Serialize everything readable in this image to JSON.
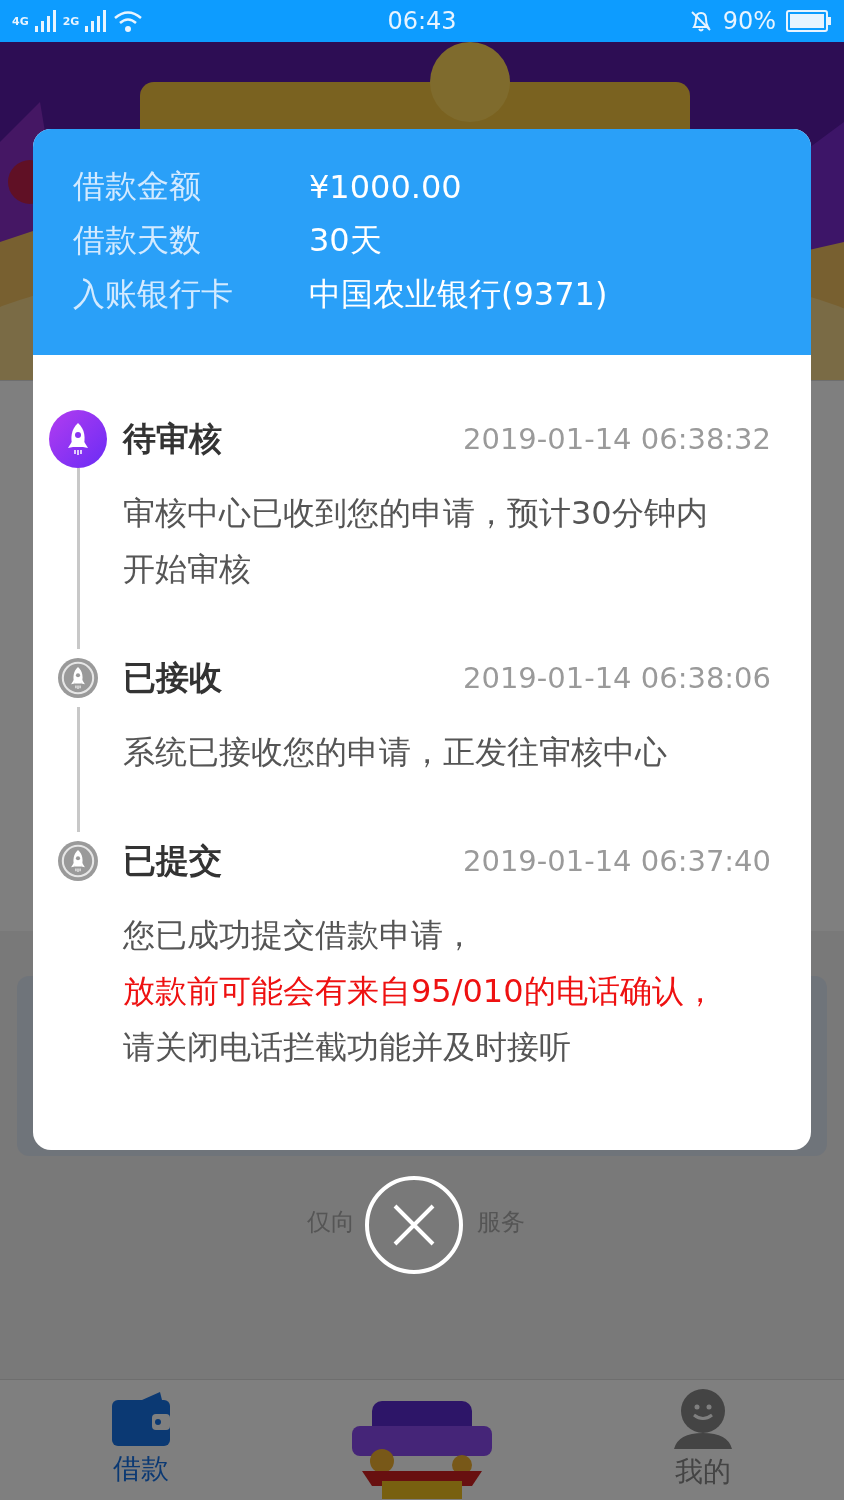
{
  "status_bar": {
    "networks": [
      "4G",
      "2G"
    ],
    "time": "06:43",
    "battery": "90%"
  },
  "dialog": {
    "summary": [
      {
        "label": "借款金额",
        "value": "¥1000.00"
      },
      {
        "label": "借款天数",
        "value": "30天"
      },
      {
        "label": "入账银行卡",
        "value": "中国农业银行(9371)"
      }
    ],
    "timeline": [
      {
        "title": "待审核",
        "time": "2019-01-14 06:38:32",
        "active": true,
        "lines": [
          {
            "text": "审核中心已收到您的申请，预计30分钟内开始审核",
            "highlight": false
          }
        ]
      },
      {
        "title": "已接收",
        "time": "2019-01-14 06:38:06",
        "active": false,
        "lines": [
          {
            "text": "系统已接收您的申请，正发往审核中心",
            "highlight": false
          }
        ]
      },
      {
        "title": "已提交",
        "time": "2019-01-14 06:37:40",
        "active": false,
        "lines": [
          {
            "text": "您已成功提交借款申请，",
            "highlight": false
          },
          {
            "text": "放款前可能会有来自95/010的电话确认，",
            "highlight": true
          },
          {
            "text": "请关闭电话拦截功能并及时接听",
            "highlight": false
          }
        ]
      }
    ]
  },
  "footer_note": [
    "仅向",
    "服务"
  ],
  "tabs": [
    {
      "kind": "wallet",
      "label": "借款",
      "selected": true
    },
    {
      "kind": "picture"
    },
    {
      "kind": "person",
      "label": "我的",
      "selected": false
    }
  ]
}
